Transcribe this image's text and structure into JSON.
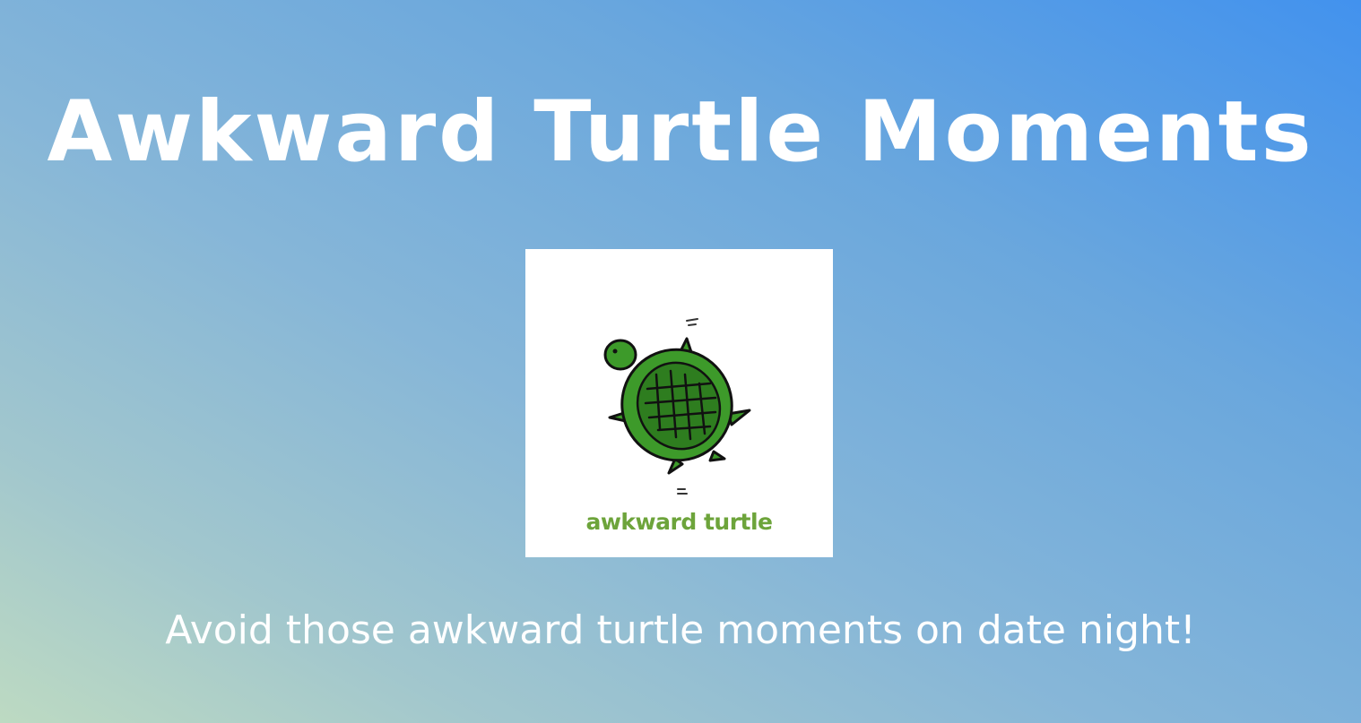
{
  "page": {
    "title": "Awkward Turtle Moments",
    "subtitle": "Avoid those awkward turtle moments on date night!"
  },
  "image": {
    "icon": "turtle-icon",
    "caption": "awkward turtle"
  },
  "colors": {
    "background_top_right": "#4292ee",
    "background_bottom_left": "#bddac2",
    "text": "#ffffff",
    "turtle_green": "#3d9a2a",
    "shell_dark": "#2e7d1f",
    "caption_green": "#6da43b"
  }
}
